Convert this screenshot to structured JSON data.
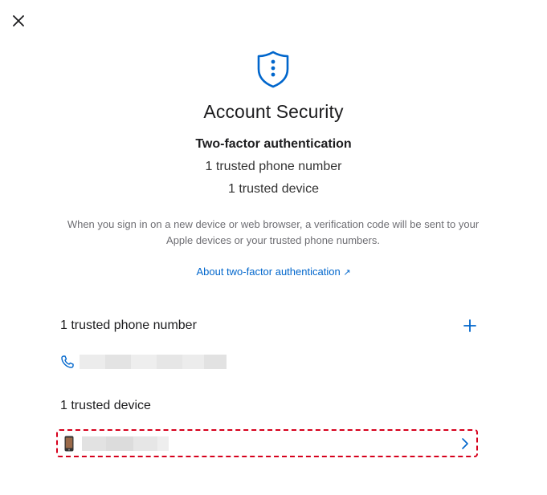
{
  "header": {
    "title": "Account Security"
  },
  "summary": {
    "auth_method": "Two-factor authentication",
    "phone_count_text": "1 trusted phone number",
    "device_count_text": "1 trusted device"
  },
  "description": "When you sign in on a new device or web browser, a verification code will be sent to your Apple devices or your trusted phone numbers.",
  "about_link": {
    "label": "About two-factor authentication",
    "arrow": "↗"
  },
  "phones_section": {
    "header": "1 trusted phone number",
    "add_icon": "plus-icon",
    "items": [
      {
        "icon": "phone-icon",
        "number_hidden": true
      }
    ]
  },
  "devices_section": {
    "header": "1 trusted device",
    "items": [
      {
        "icon": "iphone-icon",
        "name_hidden": true,
        "chevron": "chevron-right-icon"
      }
    ]
  },
  "colors": {
    "accent": "#0066cc",
    "highlight_border": "#d6001c"
  }
}
